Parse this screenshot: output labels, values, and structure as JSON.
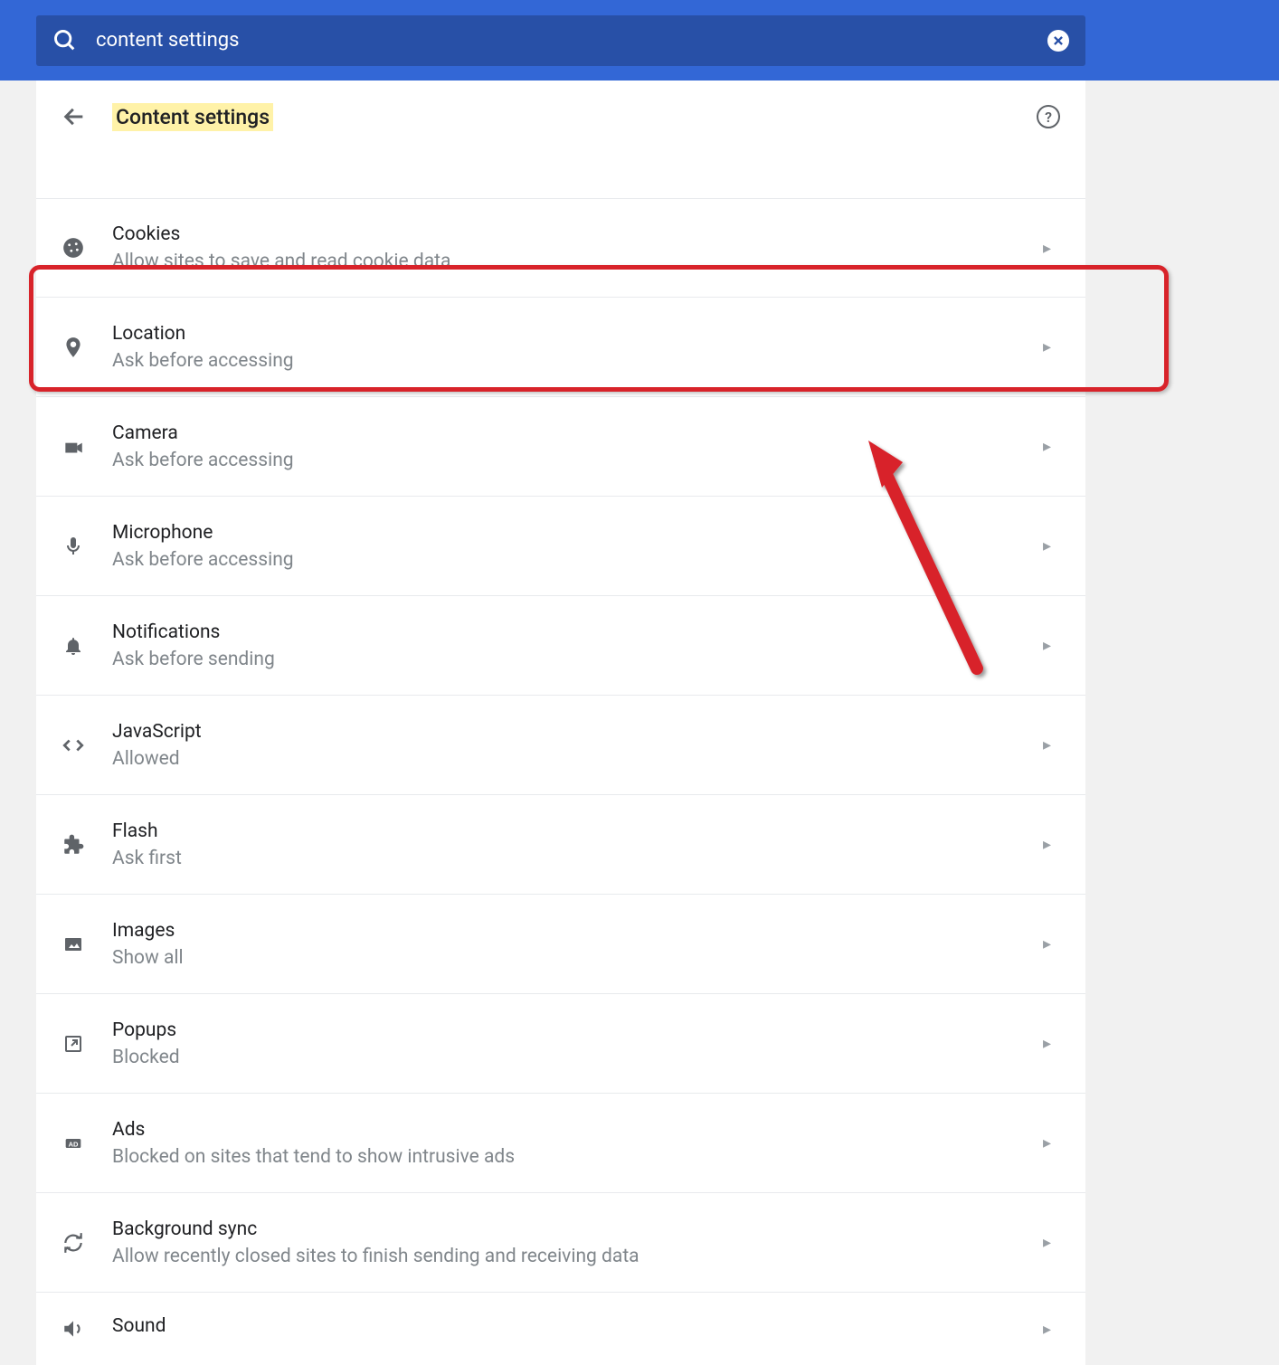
{
  "search": {
    "value": "content settings"
  },
  "header": {
    "title": "Content settings"
  },
  "settings": [
    {
      "icon": "cookie",
      "title": "Cookies",
      "subtitle": "Allow sites to save and read cookie data"
    },
    {
      "icon": "location",
      "title": "Location",
      "subtitle": "Ask before accessing"
    },
    {
      "icon": "camera",
      "title": "Camera",
      "subtitle": "Ask before accessing"
    },
    {
      "icon": "microphone",
      "title": "Microphone",
      "subtitle": "Ask before accessing"
    },
    {
      "icon": "notifications",
      "title": "Notifications",
      "subtitle": "Ask before sending"
    },
    {
      "icon": "javascript",
      "title": "JavaScript",
      "subtitle": "Allowed"
    },
    {
      "icon": "flash",
      "title": "Flash",
      "subtitle": "Ask first"
    },
    {
      "icon": "images",
      "title": "Images",
      "subtitle": "Show all"
    },
    {
      "icon": "popups",
      "title": "Popups",
      "subtitle": "Blocked"
    },
    {
      "icon": "ads",
      "title": "Ads",
      "subtitle": "Blocked on sites that tend to show intrusive ads"
    },
    {
      "icon": "sync",
      "title": "Background sync",
      "subtitle": "Allow recently closed sites to finish sending and receiving data"
    },
    {
      "icon": "sound",
      "title": "Sound",
      "subtitle": ""
    }
  ]
}
